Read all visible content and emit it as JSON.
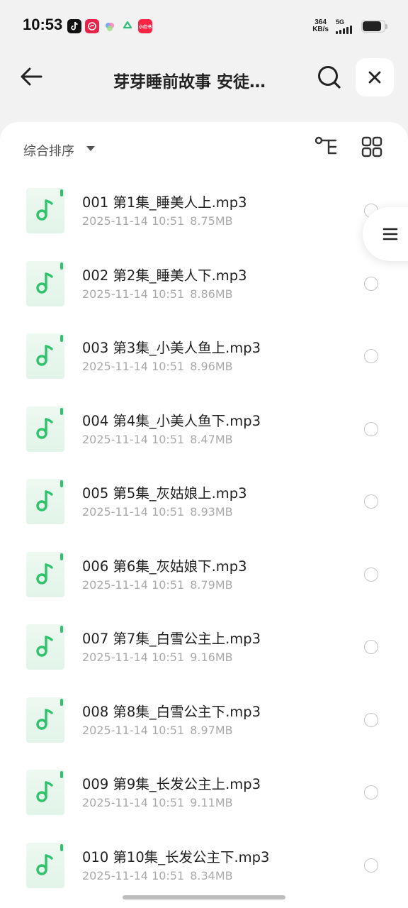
{
  "status_bar": {
    "time": "10:53",
    "net_speed_value": "364",
    "net_speed_unit": "KB/s",
    "network": "5G",
    "xhs_badge": "小红书"
  },
  "nav": {
    "title": "芽芽睡前故事 安徒…"
  },
  "toolbar": {
    "sort_label": "综合排序"
  },
  "files": [
    {
      "name": "001 第1集_睡美人上.mp3",
      "date": "2025-11-14 10:51",
      "size": "8.75MB"
    },
    {
      "name": "002 第2集_睡美人下.mp3",
      "date": "2025-11-14 10:51",
      "size": "8.86MB"
    },
    {
      "name": "003 第3集_小美人鱼上.mp3",
      "date": "2025-11-14 10:51",
      "size": "8.96MB"
    },
    {
      "name": "004 第4集_小美人鱼下.mp3",
      "date": "2025-11-14 10:51",
      "size": "8.47MB"
    },
    {
      "name": "005 第5集_灰姑娘上.mp3",
      "date": "2025-11-14 10:51",
      "size": "8.93MB"
    },
    {
      "name": "006 第6集_灰姑娘下.mp3",
      "date": "2025-11-14 10:51",
      "size": "8.79MB"
    },
    {
      "name": "007 第7集_白雪公主上.mp3",
      "date": "2025-11-14 10:51",
      "size": "9.16MB"
    },
    {
      "name": "008 第8集_白雪公主下.mp3",
      "date": "2025-11-14 10:51",
      "size": "8.97MB"
    },
    {
      "name": "009 第9集_长发公主上.mp3",
      "date": "2025-11-14 10:51",
      "size": "9.11MB"
    },
    {
      "name": "010 第10集_长发公主下.mp3",
      "date": "2025-11-14 10:51",
      "size": "8.34MB"
    }
  ],
  "colors": {
    "accent_green": "#2fc36c",
    "background": "#f2f2f2",
    "sheet": "#ffffff"
  }
}
